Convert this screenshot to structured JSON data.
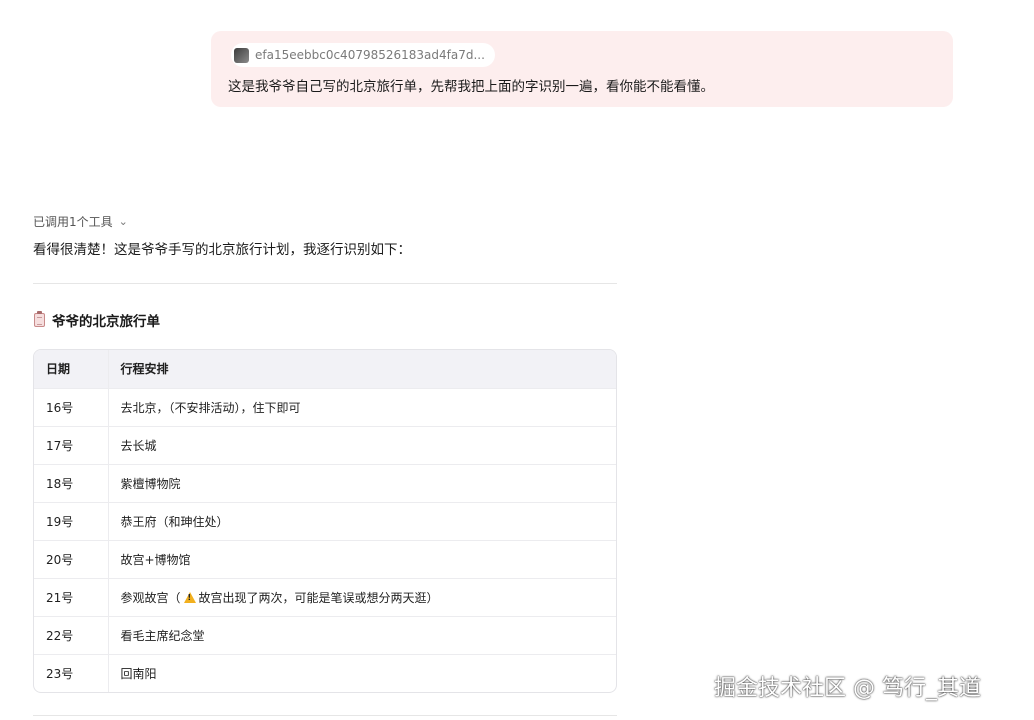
{
  "user_message": {
    "file_name": "efa15eebbc0c40798526183ad4fa7d...",
    "text": "这是我爷爷自己写的北京旅行单，先帮我把上面的字识别一遍，看你能不能看懂。"
  },
  "assistant": {
    "tool_toggle": "已调用1个工具",
    "intro": "看得很清楚！这是爷爷手写的北京旅行计划，我逐行识别如下：",
    "section_title": "爷爷的北京旅行单",
    "table": {
      "headers": [
        "日期",
        "行程安排"
      ],
      "rows": [
        {
          "date": "16号",
          "plan": "去北京，（不安排活动），住下即可"
        },
        {
          "date": "17号",
          "plan": "去长城"
        },
        {
          "date": "18号",
          "plan": "紫檀博物院"
        },
        {
          "date": "19号",
          "plan": "恭王府（和珅住处）"
        },
        {
          "date": "20号",
          "plan": "故宫+博物馆"
        },
        {
          "date": "21号",
          "plan_prefix": "参观故宫（",
          "plan_suffix": "故宫出现了两次，可能是笔误或想分两天逛）"
        },
        {
          "date": "22号",
          "plan": "看毛主席纪念堂"
        },
        {
          "date": "23号",
          "plan": "回南阳"
        }
      ]
    }
  },
  "watermark": "掘金技术社区 @ 笃行_其道",
  "icons": {
    "file": "image-thumbnail-icon",
    "chevron": "chevron-down-icon",
    "section": "clipboard-icon",
    "warning": "warning-icon"
  },
  "colors": {
    "user_bubble_bg": "#fdeeee",
    "table_header_bg": "#f2f2f6",
    "warning": "#f2b01e"
  }
}
